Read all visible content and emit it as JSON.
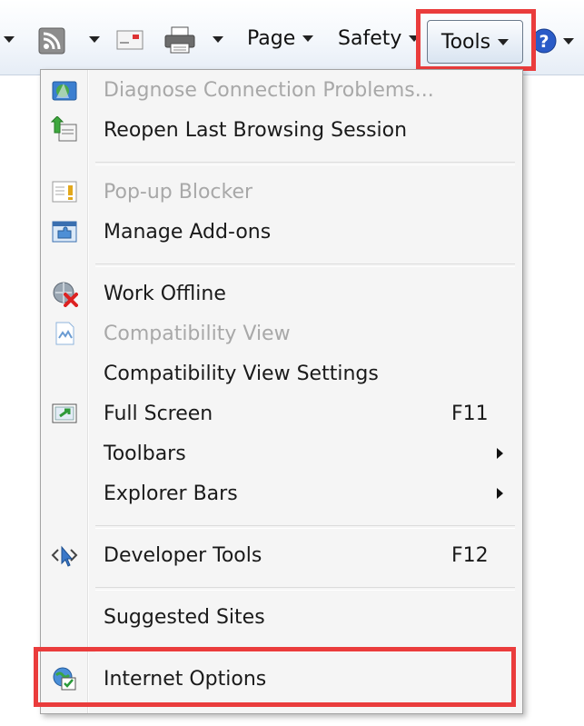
{
  "toolbar": {
    "page_label": "Page",
    "safety_label": "Safety",
    "tools_label": "Tools"
  },
  "menu": {
    "items": [
      {
        "label": "Diagnose Connection Problems...",
        "enabled": false,
        "icon": "network-diagnose-icon"
      },
      {
        "label": "Reopen Last Browsing Session",
        "enabled": true,
        "icon": "reopen-session-icon"
      },
      {
        "label": "Pop-up Blocker",
        "enabled": false,
        "icon": "popup-blocker-icon"
      },
      {
        "label": "Manage Add-ons",
        "enabled": true,
        "icon": "addons-icon"
      },
      {
        "label": "Work Offline",
        "enabled": true,
        "icon": "work-offline-icon"
      },
      {
        "label": "Compatibility View",
        "enabled": false,
        "icon": "compatibility-view-icon"
      },
      {
        "label": "Compatibility View Settings",
        "enabled": true
      },
      {
        "label": "Full Screen",
        "shortcut": "F11",
        "enabled": true,
        "icon": "full-screen-icon"
      },
      {
        "label": "Toolbars",
        "enabled": true,
        "submenu": true
      },
      {
        "label": "Explorer Bars",
        "enabled": true,
        "submenu": true
      },
      {
        "label": "Developer Tools",
        "shortcut": "F12",
        "enabled": true,
        "icon": "developer-tools-icon"
      },
      {
        "label": "Suggested Sites",
        "enabled": true
      },
      {
        "label": "Internet Options",
        "enabled": true,
        "icon": "internet-options-icon"
      }
    ]
  },
  "colors": {
    "highlight_box": "#ea3c3c",
    "disabled_text": "#a8a8a8"
  }
}
